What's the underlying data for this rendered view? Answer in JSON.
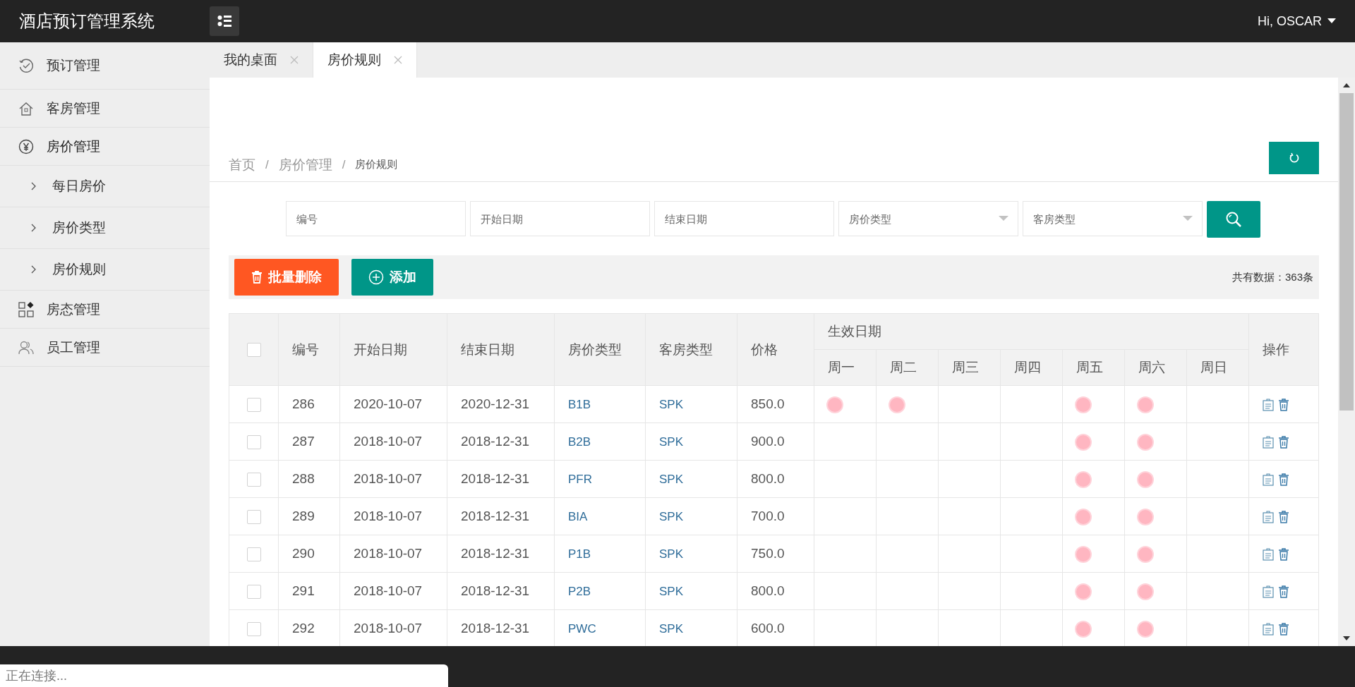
{
  "header": {
    "title": "酒店预订管理系统",
    "user": "Hi, OSCAR"
  },
  "sidebar": {
    "items": [
      {
        "label": "预订管理",
        "expanded": false
      },
      {
        "label": "客房管理",
        "expanded": false
      },
      {
        "label": "房价管理",
        "expanded": true,
        "children": [
          {
            "label": "每日房价"
          },
          {
            "label": "房价类型"
          },
          {
            "label": "房价规则"
          }
        ]
      },
      {
        "label": "房态管理",
        "expanded": false
      },
      {
        "label": "员工管理",
        "expanded": false
      }
    ]
  },
  "tabs": [
    {
      "label": "我的桌面",
      "selected": false
    },
    {
      "label": "房价规则",
      "selected": true
    }
  ],
  "breadcrumb": {
    "items": [
      "首页",
      "房价管理",
      "房价规则"
    ],
    "separator": "/"
  },
  "search": {
    "fields": [
      {
        "placeholder": "编号",
        "kind": "text"
      },
      {
        "placeholder": "开始日期",
        "kind": "text"
      },
      {
        "placeholder": "结束日期",
        "kind": "text"
      },
      {
        "placeholder": "房价类型",
        "kind": "select"
      },
      {
        "placeholder": "客房类型",
        "kind": "select"
      }
    ]
  },
  "toolbar": {
    "buttons": [
      {
        "label": "批量删除",
        "kind": "danger"
      },
      {
        "label": "添加",
        "kind": "primary"
      }
    ],
    "count": "共有数据：363条"
  },
  "table": {
    "select_all_checked": false,
    "columns": [
      "编号",
      "开始日期",
      "结束日期",
      "房价类型",
      "客房类型",
      "价格"
    ],
    "group": "生效日期",
    "days": [
      "周一",
      "周二",
      "周三",
      "周四",
      "周五",
      "周六",
      "周日"
    ],
    "actions": "操作",
    "rows": [
      {
        "checked": false,
        "id": "286",
        "start": "2020-10-07",
        "end": "2020-12-31",
        "price_type": "B1B",
        "room_type": "SPK",
        "price": "850.0",
        "days": [
          true,
          true,
          false,
          false,
          true,
          true,
          false
        ]
      },
      {
        "checked": false,
        "id": "287",
        "start": "2018-10-07",
        "end": "2018-12-31",
        "price_type": "B2B",
        "room_type": "SPK",
        "price": "900.0",
        "days": [
          false,
          false,
          false,
          false,
          true,
          true,
          false
        ]
      },
      {
        "checked": false,
        "id": "288",
        "start": "2018-10-07",
        "end": "2018-12-31",
        "price_type": "PFR",
        "room_type": "SPK",
        "price": "800.0",
        "days": [
          false,
          false,
          false,
          false,
          true,
          true,
          false
        ]
      },
      {
        "checked": false,
        "id": "289",
        "start": "2018-10-07",
        "end": "2018-12-31",
        "price_type": "BIA",
        "room_type": "SPK",
        "price": "700.0",
        "days": [
          false,
          false,
          false,
          false,
          true,
          true,
          false
        ]
      },
      {
        "checked": false,
        "id": "290",
        "start": "2018-10-07",
        "end": "2018-12-31",
        "price_type": "P1B",
        "room_type": "SPK",
        "price": "750.0",
        "days": [
          false,
          false,
          false,
          false,
          true,
          true,
          false
        ]
      },
      {
        "checked": false,
        "id": "291",
        "start": "2018-10-07",
        "end": "2018-12-31",
        "price_type": "P2B",
        "room_type": "SPK",
        "price": "800.0",
        "days": [
          false,
          false,
          false,
          false,
          true,
          true,
          false
        ]
      },
      {
        "checked": false,
        "id": "292",
        "start": "2018-10-07",
        "end": "2018-12-31",
        "price_type": "PWC",
        "room_type": "SPK",
        "price": "600.0",
        "days": [
          false,
          false,
          false,
          false,
          true,
          true,
          false
        ]
      }
    ]
  },
  "status_bar": {
    "text": "正在连接..."
  }
}
